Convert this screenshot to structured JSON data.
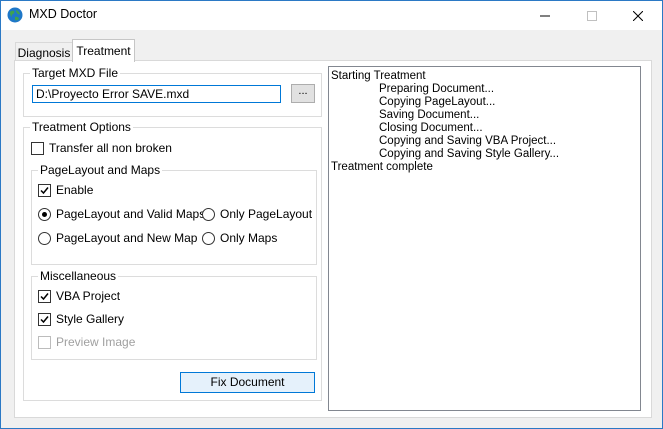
{
  "window": {
    "title": "MXD Doctor"
  },
  "tabs": [
    {
      "label": "Diagnosis"
    },
    {
      "label": "Treatment"
    }
  ],
  "target": {
    "legend": "Target MXD File",
    "path_value": "D:\\Proyecto Error SAVE.mxd",
    "browse_label": "..."
  },
  "options": {
    "legend": "Treatment Options",
    "transfer_label": "Transfer all non broken",
    "pagelayout": {
      "legend": "PageLayout and Maps",
      "enable_label": "Enable",
      "radios": [
        {
          "label": "PageLayout and Valid Maps",
          "selected": true
        },
        {
          "label": "Only PageLayout",
          "selected": false
        },
        {
          "label": "PageLayout and New Map",
          "selected": false
        },
        {
          "label": "Only Maps",
          "selected": false
        }
      ]
    },
    "misc": {
      "legend": "Miscellaneous",
      "vba_label": "VBA Project",
      "style_label": "Style Gallery",
      "preview_label": "Preview Image"
    }
  },
  "fix_button_label": "Fix Document",
  "log": [
    {
      "text": "Starting Treatment",
      "indent": false
    },
    {
      "text": "Preparing Document...",
      "indent": true
    },
    {
      "text": "Copying PageLayout...",
      "indent": true
    },
    {
      "text": "Saving Document...",
      "indent": true
    },
    {
      "text": "Closing Document...",
      "indent": true
    },
    {
      "text": "Copying and Saving VBA Project...",
      "indent": true
    },
    {
      "text": "Copying and Saving Style Gallery...",
      "indent": true
    },
    {
      "text": "Treatment complete",
      "indent": false
    }
  ]
}
